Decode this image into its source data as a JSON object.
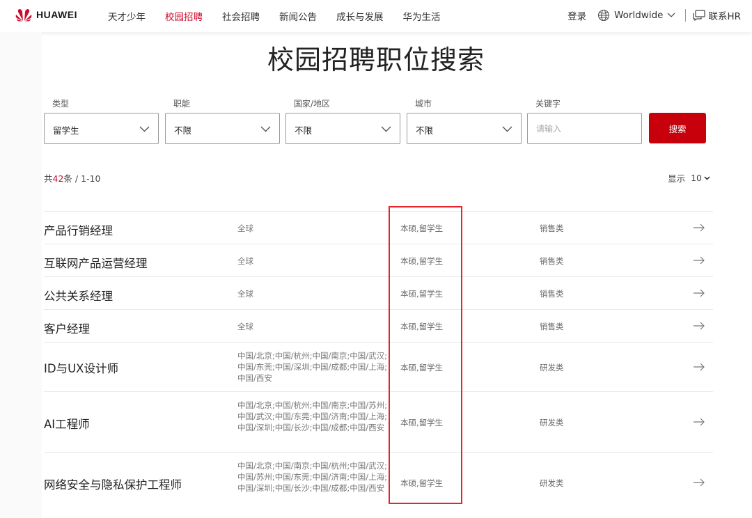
{
  "header": {
    "brand": "HUAWEI",
    "nav": [
      "天才少年",
      "校园招聘",
      "社会招聘",
      "新闻公告",
      "成长与发展",
      "华为生活"
    ],
    "active_nav_index": 1,
    "login": "登录",
    "language": "Worldwide",
    "contact_hr": "联系HR"
  },
  "page": {
    "title": "校园招聘职位搜索"
  },
  "filters": [
    {
      "label": "类型",
      "value": "留学生"
    },
    {
      "label": "职能",
      "value": "不限"
    },
    {
      "label": "国家/地区",
      "value": "不限"
    },
    {
      "label": "城市",
      "value": "不限"
    }
  ],
  "keyword": {
    "label": "关键字",
    "placeholder": "请输入"
  },
  "search_button": "搜索",
  "results": {
    "prefix": "共",
    "total": "42",
    "suffix": "条 / 1-10",
    "show_label": "显示",
    "page_size": "10"
  },
  "jobs": [
    {
      "title": "产品行销经理",
      "location": "全球",
      "education": "本硕,留学生",
      "category": "销售类"
    },
    {
      "title": "互联网产品运营经理",
      "location": "全球",
      "education": "本硕,留学生",
      "category": "销售类"
    },
    {
      "title": "公共关系经理",
      "location": "全球",
      "education": "本硕,留学生",
      "category": "销售类"
    },
    {
      "title": "客户经理",
      "location": "全球",
      "education": "本硕,留学生",
      "category": "销售类"
    },
    {
      "title": "ID与UX设计师",
      "location": "中国/北京;中国/杭州;中国/南京;中国/武汉;中国/东莞;中国/深圳;中国/成都;中国/上海;中国/西安",
      "education": "本硕,留学生",
      "category": "研发类"
    },
    {
      "title": "AI工程师",
      "location": "中国/北京;中国/杭州;中国/南京;中国/苏州;中国/武汉;中国/东莞;中国/济南;中国/上海;中国/深圳;中国/长沙;中国/成都;中国/西安",
      "education": "本硕,留学生",
      "category": "研发类"
    },
    {
      "title": "网络安全与隐私保护工程师",
      "location": "中国/北京;中国/南京;中国/杭州;中国/武汉;中国/苏州;中国/东莞;中国/济南;中国/上海;中国/深圳;中国/长沙;中国/成都;中国/西安",
      "education": "本硕,留学生",
      "category": "研发类"
    }
  ],
  "colors": {
    "brand_red": "#c7000b",
    "highlight": "#e8232e",
    "active_nav": "#cf0a2c"
  },
  "icons": {
    "logo": "huawei-logo-icon",
    "globe": "globe-icon",
    "chevron": "chevron-down-icon",
    "chat": "chat-icon",
    "arrow": "arrow-right-icon"
  }
}
